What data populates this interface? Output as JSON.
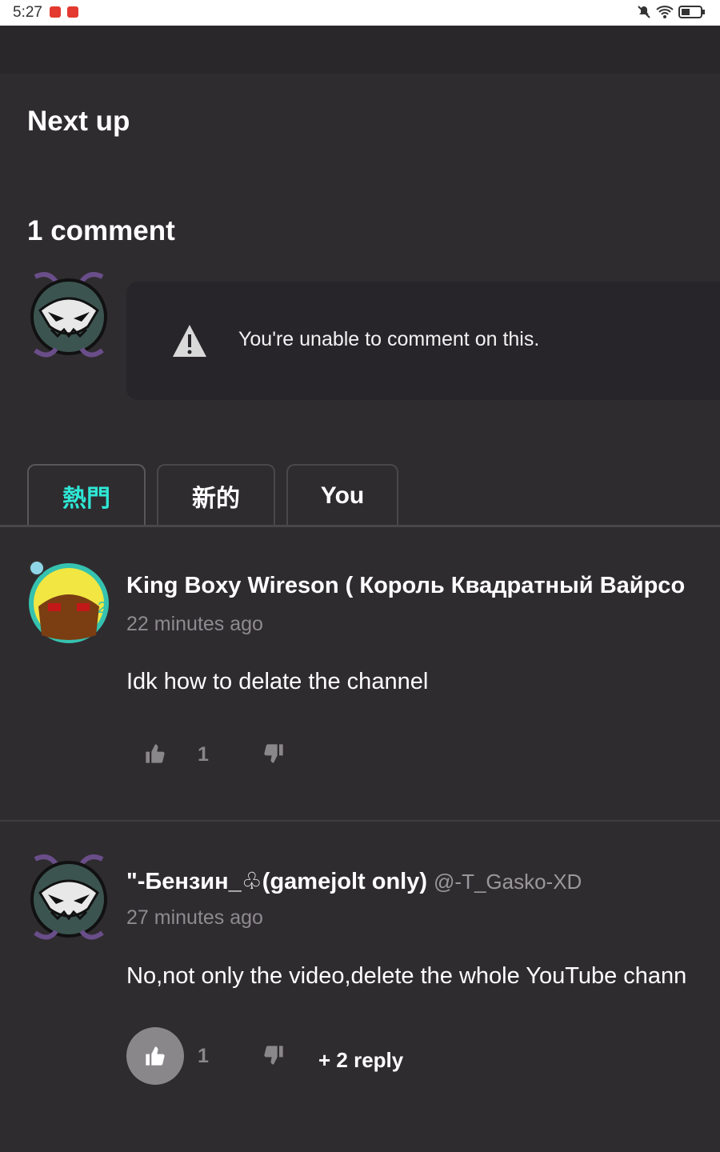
{
  "status": {
    "time": "5:27"
  },
  "next_up": "Next up",
  "comments_header": "1 comment",
  "notice": "You're unable to comment on this.",
  "tabs": [
    {
      "label": "熱門",
      "active": true
    },
    {
      "label": "新的",
      "active": false
    },
    {
      "label": "You",
      "active": false
    }
  ],
  "comments": [
    {
      "name": "King Boxy Wireson ( Король Квадратный Вайрсо",
      "handle": "",
      "time": "22 minutes ago",
      "text": "Idk how to delate the channel",
      "likes": "1"
    },
    {
      "name": "\"-Бензин_♧(gamejolt only)",
      "handle": "@-T_Gasko-XD",
      "time": "27 minutes ago",
      "text": "No,not only the video,delete the whole YouTube chann",
      "likes": "1",
      "reply_label": "+ 2 reply"
    }
  ],
  "colors": {
    "accent": "#2ee8d6",
    "background": "#2f2c30"
  }
}
